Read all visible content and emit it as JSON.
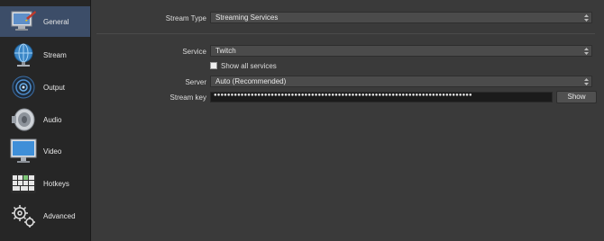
{
  "sidebar": {
    "items": [
      {
        "label": "General",
        "icon": "general-icon",
        "active": true
      },
      {
        "label": "Stream",
        "icon": "globe-icon",
        "active": false
      },
      {
        "label": "Output",
        "icon": "signal-icon",
        "active": false
      },
      {
        "label": "Audio",
        "icon": "speaker-icon",
        "active": false
      },
      {
        "label": "Video",
        "icon": "monitor-icon",
        "active": false
      },
      {
        "label": "Hotkeys",
        "icon": "keyboard-icon",
        "active": false
      },
      {
        "label": "Advanced",
        "icon": "gears-icon",
        "active": false
      }
    ]
  },
  "stream": {
    "type_label": "Stream Type",
    "type_value": "Streaming Services",
    "service_label": "Service",
    "service_value": "Twitch",
    "show_all_label": "Show all services",
    "show_all_checked": false,
    "server_label": "Server",
    "server_value": "Auto (Recommended)",
    "key_label": "Stream key",
    "key_value": "●●●●●●●●●●●●●●●●●●●●●●●●●●●●●●●●●●●●●●●●●●●●●●●●●●●●●●●●●●●●●●●●●●●●●●●●●●●●●",
    "show_button": "Show"
  },
  "colors": {
    "accent": "#3c4d68",
    "sidebar_bg": "#262626",
    "panel_bg": "#3a3a3a"
  }
}
